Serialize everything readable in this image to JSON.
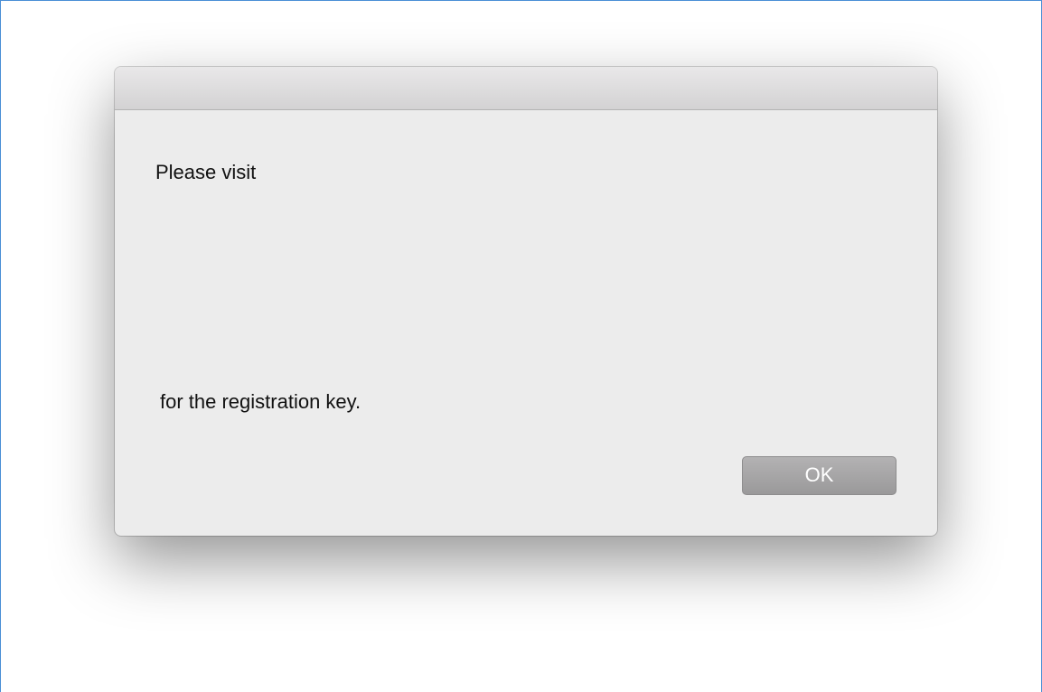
{
  "dialog": {
    "message_line1": "Please visit",
    "message_line2": "for the registration key.",
    "ok_label": "OK"
  }
}
